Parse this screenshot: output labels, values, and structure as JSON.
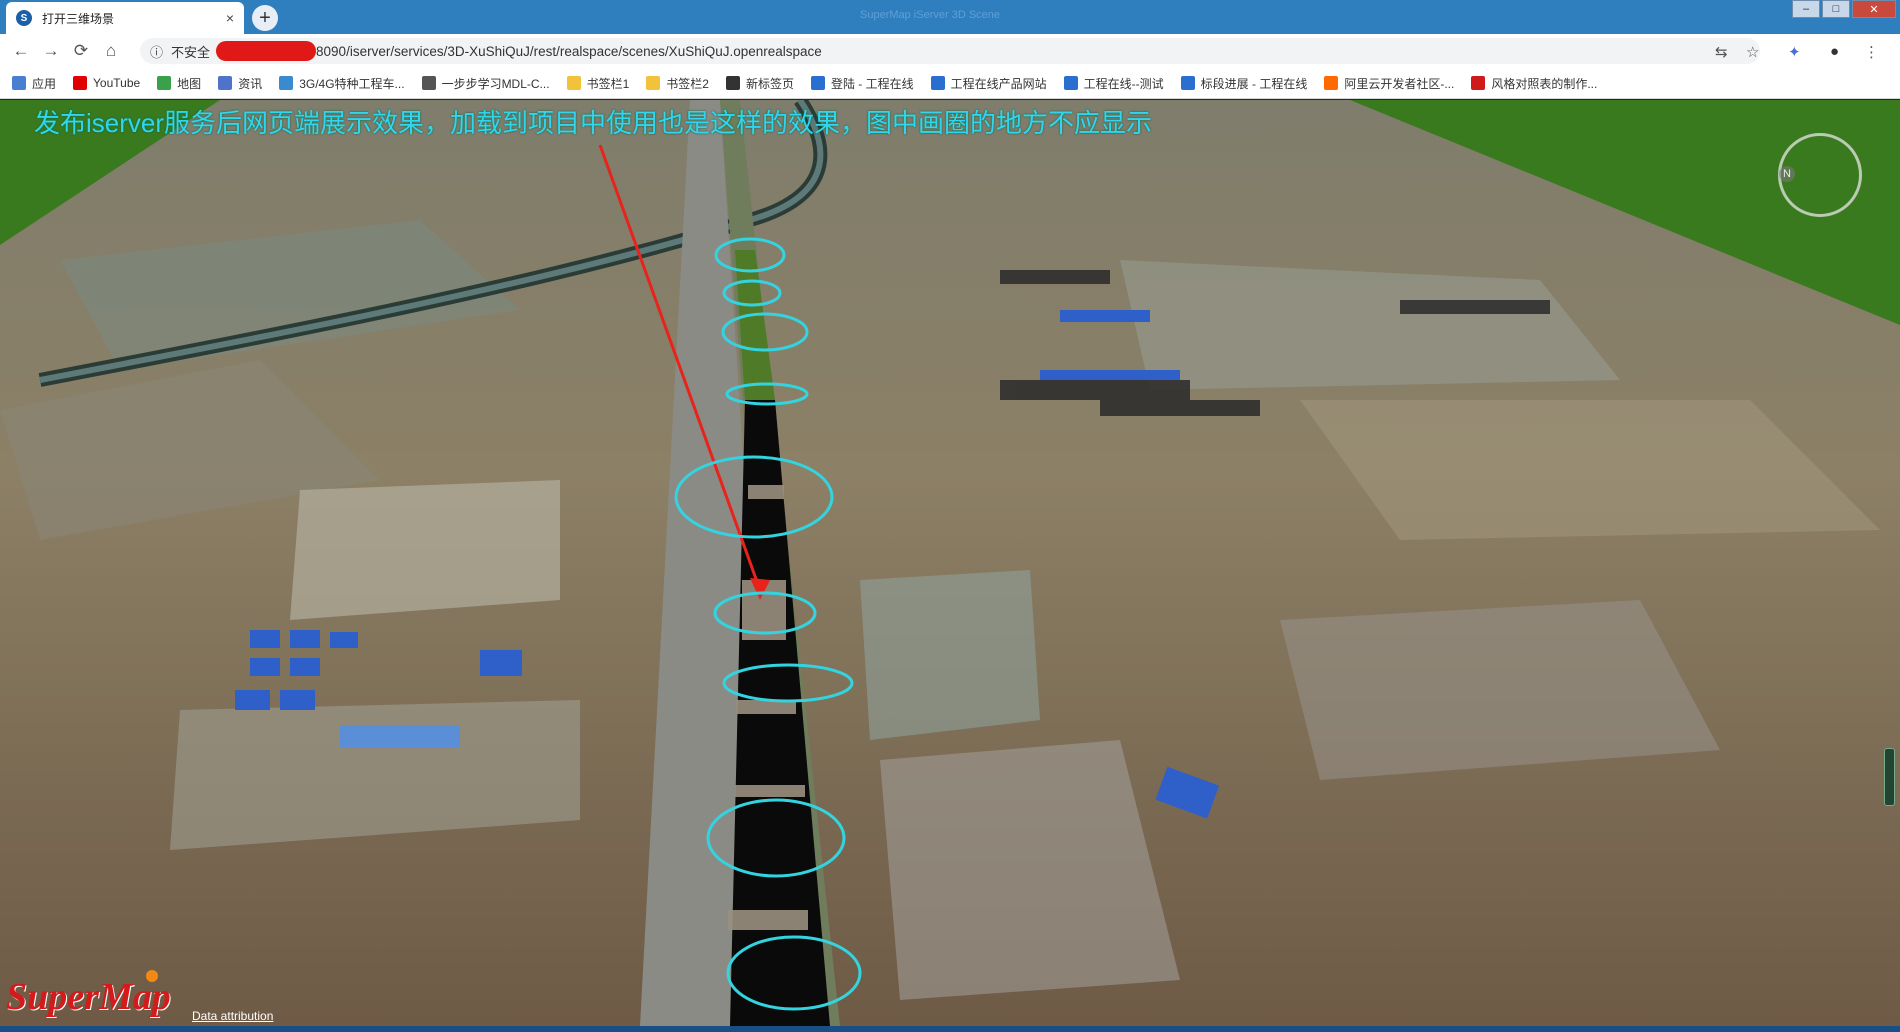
{
  "browser": {
    "tab_title": "打开三维场景",
    "tab_close": "×",
    "new_tab": "+",
    "favicon": "S",
    "window_title": "SuperMap iServer 3D Scene"
  },
  "window_controls": {
    "minimize": "–",
    "maximize": "□",
    "close": "✕"
  },
  "toolbar": {
    "back": "←",
    "forward": "→",
    "reload": "⟳",
    "home": "⌂",
    "info_icon": "ⓘ",
    "insecure_label": "不安全",
    "url": "8090/iserver/services/3D-XuShiQuJ/rest/realspace/scenes/XuShiQuJ.openrealspace",
    "translate": "⇆",
    "star": "☆",
    "extension": "✦",
    "account": "●",
    "menu": "⋮"
  },
  "bookmarks": [
    {
      "label": "应用",
      "icon": "apps-icon",
      "color": "#4a7fd0"
    },
    {
      "label": "YouTube",
      "icon": "youtube-icon",
      "color": "#e00000"
    },
    {
      "label": "地图",
      "icon": "map-icon",
      "color": "#3aa04a"
    },
    {
      "label": "资讯",
      "icon": "news-icon",
      "color": "#4e73c9"
    },
    {
      "label": "3G/4G特种工程车...",
      "icon": "cloud-icon",
      "color": "#3a8ad0"
    },
    {
      "label": "一步步学习MDL-C...",
      "icon": "page-icon",
      "color": "#555555"
    },
    {
      "label": "书签栏1",
      "icon": "folder-icon",
      "color": "#f2c23a"
    },
    {
      "label": "书签栏2",
      "icon": "folder-icon",
      "color": "#f2c23a"
    },
    {
      "label": "新标签页",
      "icon": "globe-icon",
      "color": "#333333"
    },
    {
      "label": "登陆 - 工程在线",
      "icon": "site-icon",
      "color": "#2a6fd0"
    },
    {
      "label": "工程在线产品网站",
      "icon": "site-icon",
      "color": "#2a6fd0"
    },
    {
      "label": "工程在线--测试",
      "icon": "site-icon",
      "color": "#2a6fd0"
    },
    {
      "label": "标段进展 - 工程在线",
      "icon": "site-icon",
      "color": "#2a6fd0"
    },
    {
      "label": "阿里云开发者社区-...",
      "icon": "aliyun-icon",
      "color": "#ff6a00"
    },
    {
      "label": "风格对照表的制作...",
      "icon": "c-icon",
      "color": "#d01a1a"
    }
  ],
  "scene": {
    "caption": "发布iserver服务后网页端展示效果，加载到项目中使用也是这样的效果，图中画圈的地方不应显示",
    "compass_label": "N",
    "logo": "SuperMap",
    "attribution": "Data attribution",
    "highlight_color": "#33d4e0",
    "arrow_color": "#e8231c"
  }
}
